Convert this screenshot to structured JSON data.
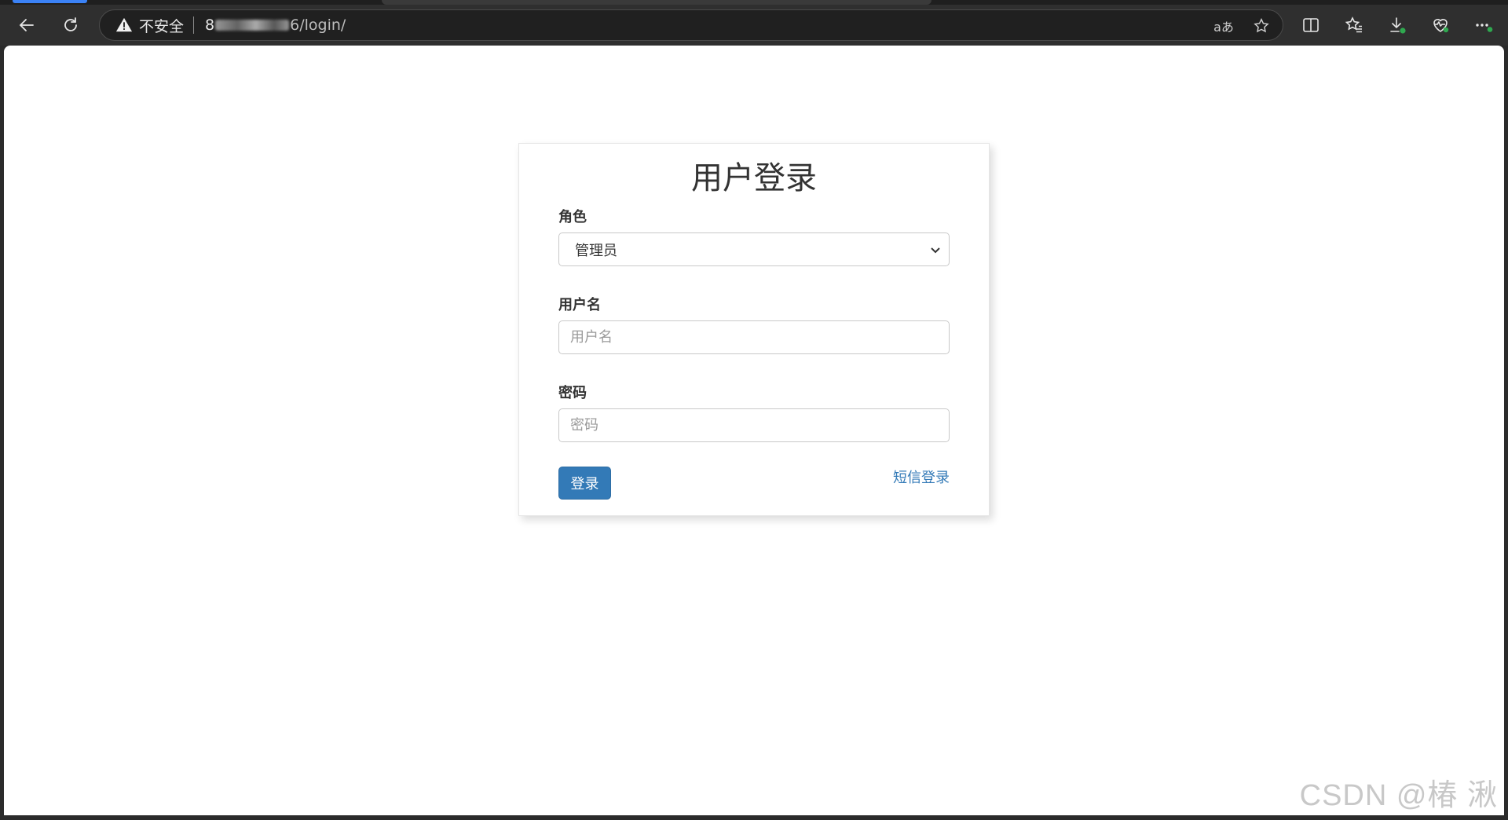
{
  "browser": {
    "security_label": "不安全",
    "url_prefix": "8",
    "url_suffix": "6/login/",
    "icons": {
      "back": "back-arrow-icon",
      "refresh": "refresh-icon",
      "warning": "warning-icon",
      "read_aloud": "read-aloud-icon",
      "read_aloud_text": "aあ",
      "favorite": "star-icon",
      "split_screen": "split-screen-icon",
      "favorites": "favorites-icon",
      "downloads": "download-icon",
      "health": "heartbeat-icon",
      "more": "more-icon"
    }
  },
  "login": {
    "title": "用户登录",
    "role_label": "角色",
    "role_selected": "管理员",
    "username_label": "用户名",
    "username_placeholder": "用户名",
    "password_label": "密码",
    "password_placeholder": "密码",
    "submit_label": "登录",
    "sms_link": "短信登录"
  },
  "watermark": "CSDN @椿  湫",
  "colors": {
    "primary": "#337ab7",
    "page_bg": "#ffffff",
    "chrome_bg": "#2f2f2f"
  }
}
